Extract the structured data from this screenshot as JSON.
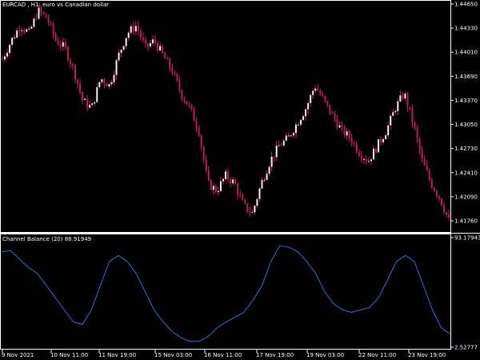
{
  "main_chart": {
    "title": "EURCAD , H1:  euro vs Canadian dollar",
    "price_labels": [
      "1.44650",
      "1.44330",
      "1.44010",
      "1.43690",
      "1.43370",
      "1.43050",
      "1.42730",
      "1.42410",
      "1.42090",
      "1.41760"
    ],
    "colors": {
      "bull": "#f2f2f2",
      "bear": "#c2185b",
      "wick": "#d81b60"
    }
  },
  "indicator": {
    "title": "Channel Balance (20) 88.91949",
    "scale_labels": [
      "93.17943",
      "2.52777"
    ],
    "color": "#2f6fd6"
  },
  "time_axis": {
    "labels": [
      "9 Nov 2021",
      "10 Nov 11:00",
      "11 Nov 19:00",
      "15 Nov 03:00",
      "16 Nov 11:00",
      "17 Nov 19:00",
      "19 Nov 03:00",
      "22 Nov 11:00",
      "23 Nov 19:00"
    ]
  },
  "chart_data": [
    {
      "type": "candlestick",
      "title": "EURCAD , H1:  euro vs Canadian dollar",
      "x_labels": [
        "9 Nov 2021",
        "10 Nov 11:00",
        "11 Nov 19:00",
        "15 Nov 03:00",
        "16 Nov 11:00",
        "17 Nov 19:00",
        "19 Nov 03:00",
        "22 Nov 11:00",
        "23 Nov 19:00"
      ],
      "ylim": [
        1.4165,
        1.4474
      ],
      "y_ticks": [
        1.4465,
        1.4433,
        1.4401,
        1.4369,
        1.4337,
        1.4305,
        1.4273,
        1.4241,
        1.4209,
        1.4176
      ],
      "close_path": [
        1.4395,
        1.442,
        1.444,
        1.443,
        1.446,
        1.445,
        1.442,
        1.441,
        1.438,
        1.434,
        1.433,
        1.437,
        1.436,
        1.44,
        1.443,
        1.444,
        1.441,
        1.442,
        1.44,
        1.438,
        1.435,
        1.433,
        1.43,
        1.423,
        1.422,
        1.424,
        1.423,
        1.42,
        1.419,
        1.423,
        1.426,
        1.428,
        1.429,
        1.431,
        1.433,
        1.436,
        1.434,
        1.432,
        1.43,
        1.429,
        1.427,
        1.426,
        1.428,
        1.43,
        1.433,
        1.435,
        1.431,
        1.426,
        1.423,
        1.421,
        1.418
      ]
    },
    {
      "type": "line",
      "title": "Channel Balance (20) 88.91949",
      "ylim": [
        2.52777,
        93.17943
      ],
      "values": [
        88,
        89,
        82,
        75,
        70,
        60,
        50,
        40,
        30,
        28,
        40,
        60,
        80,
        85,
        80,
        70,
        55,
        40,
        30,
        22,
        17,
        14,
        14,
        18,
        25,
        30,
        34,
        38,
        48,
        60,
        80,
        93,
        92,
        88,
        80,
        70,
        55,
        45,
        40,
        38,
        40,
        42,
        50,
        65,
        80,
        85,
        80,
        60,
        40,
        25,
        20
      ]
    }
  ]
}
